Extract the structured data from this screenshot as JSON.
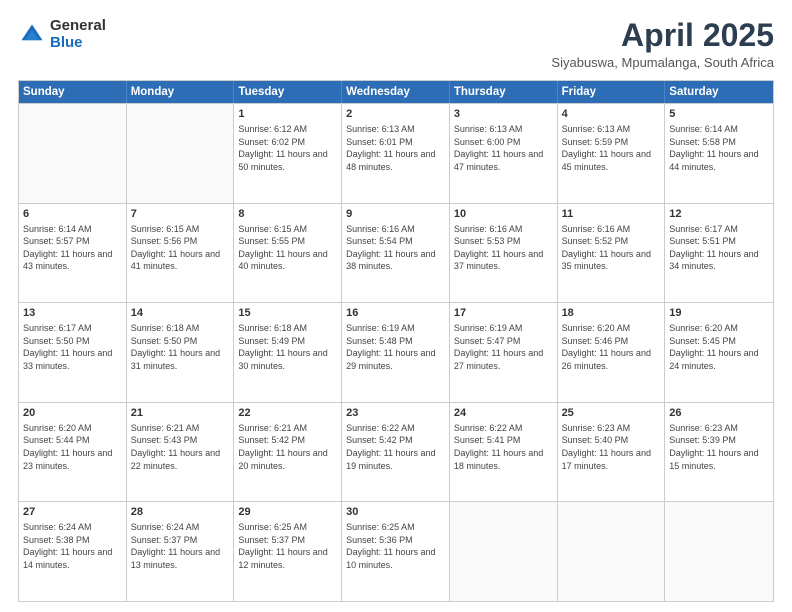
{
  "header": {
    "logo": {
      "general": "General",
      "blue": "Blue"
    },
    "title": "April 2025",
    "location": "Siyabuswa, Mpumalanga, South Africa"
  },
  "days_of_week": [
    "Sunday",
    "Monday",
    "Tuesday",
    "Wednesday",
    "Thursday",
    "Friday",
    "Saturday"
  ],
  "weeks": [
    [
      {
        "day": "",
        "empty": true
      },
      {
        "day": "",
        "empty": true
      },
      {
        "day": "1",
        "sunrise": "6:12 AM",
        "sunset": "6:02 PM",
        "daylight": "11 hours and 50 minutes."
      },
      {
        "day": "2",
        "sunrise": "6:13 AM",
        "sunset": "6:01 PM",
        "daylight": "11 hours and 48 minutes."
      },
      {
        "day": "3",
        "sunrise": "6:13 AM",
        "sunset": "6:00 PM",
        "daylight": "11 hours and 47 minutes."
      },
      {
        "day": "4",
        "sunrise": "6:13 AM",
        "sunset": "5:59 PM",
        "daylight": "11 hours and 45 minutes."
      },
      {
        "day": "5",
        "sunrise": "6:14 AM",
        "sunset": "5:58 PM",
        "daylight": "11 hours and 44 minutes."
      }
    ],
    [
      {
        "day": "6",
        "sunrise": "6:14 AM",
        "sunset": "5:57 PM",
        "daylight": "11 hours and 43 minutes."
      },
      {
        "day": "7",
        "sunrise": "6:15 AM",
        "sunset": "5:56 PM",
        "daylight": "11 hours and 41 minutes."
      },
      {
        "day": "8",
        "sunrise": "6:15 AM",
        "sunset": "5:55 PM",
        "daylight": "11 hours and 40 minutes."
      },
      {
        "day": "9",
        "sunrise": "6:16 AM",
        "sunset": "5:54 PM",
        "daylight": "11 hours and 38 minutes."
      },
      {
        "day": "10",
        "sunrise": "6:16 AM",
        "sunset": "5:53 PM",
        "daylight": "11 hours and 37 minutes."
      },
      {
        "day": "11",
        "sunrise": "6:16 AM",
        "sunset": "5:52 PM",
        "daylight": "11 hours and 35 minutes."
      },
      {
        "day": "12",
        "sunrise": "6:17 AM",
        "sunset": "5:51 PM",
        "daylight": "11 hours and 34 minutes."
      }
    ],
    [
      {
        "day": "13",
        "sunrise": "6:17 AM",
        "sunset": "5:50 PM",
        "daylight": "11 hours and 33 minutes."
      },
      {
        "day": "14",
        "sunrise": "6:18 AM",
        "sunset": "5:50 PM",
        "daylight": "11 hours and 31 minutes."
      },
      {
        "day": "15",
        "sunrise": "6:18 AM",
        "sunset": "5:49 PM",
        "daylight": "11 hours and 30 minutes."
      },
      {
        "day": "16",
        "sunrise": "6:19 AM",
        "sunset": "5:48 PM",
        "daylight": "11 hours and 29 minutes."
      },
      {
        "day": "17",
        "sunrise": "6:19 AM",
        "sunset": "5:47 PM",
        "daylight": "11 hours and 27 minutes."
      },
      {
        "day": "18",
        "sunrise": "6:20 AM",
        "sunset": "5:46 PM",
        "daylight": "11 hours and 26 minutes."
      },
      {
        "day": "19",
        "sunrise": "6:20 AM",
        "sunset": "5:45 PM",
        "daylight": "11 hours and 24 minutes."
      }
    ],
    [
      {
        "day": "20",
        "sunrise": "6:20 AM",
        "sunset": "5:44 PM",
        "daylight": "11 hours and 23 minutes."
      },
      {
        "day": "21",
        "sunrise": "6:21 AM",
        "sunset": "5:43 PM",
        "daylight": "11 hours and 22 minutes."
      },
      {
        "day": "22",
        "sunrise": "6:21 AM",
        "sunset": "5:42 PM",
        "daylight": "11 hours and 20 minutes."
      },
      {
        "day": "23",
        "sunrise": "6:22 AM",
        "sunset": "5:42 PM",
        "daylight": "11 hours and 19 minutes."
      },
      {
        "day": "24",
        "sunrise": "6:22 AM",
        "sunset": "5:41 PM",
        "daylight": "11 hours and 18 minutes."
      },
      {
        "day": "25",
        "sunrise": "6:23 AM",
        "sunset": "5:40 PM",
        "daylight": "11 hours and 17 minutes."
      },
      {
        "day": "26",
        "sunrise": "6:23 AM",
        "sunset": "5:39 PM",
        "daylight": "11 hours and 15 minutes."
      }
    ],
    [
      {
        "day": "27",
        "sunrise": "6:24 AM",
        "sunset": "5:38 PM",
        "daylight": "11 hours and 14 minutes."
      },
      {
        "day": "28",
        "sunrise": "6:24 AM",
        "sunset": "5:37 PM",
        "daylight": "11 hours and 13 minutes."
      },
      {
        "day": "29",
        "sunrise": "6:25 AM",
        "sunset": "5:37 PM",
        "daylight": "11 hours and 12 minutes."
      },
      {
        "day": "30",
        "sunrise": "6:25 AM",
        "sunset": "5:36 PM",
        "daylight": "11 hours and 10 minutes."
      },
      {
        "day": "",
        "empty": true
      },
      {
        "day": "",
        "empty": true
      },
      {
        "day": "",
        "empty": true
      }
    ]
  ]
}
